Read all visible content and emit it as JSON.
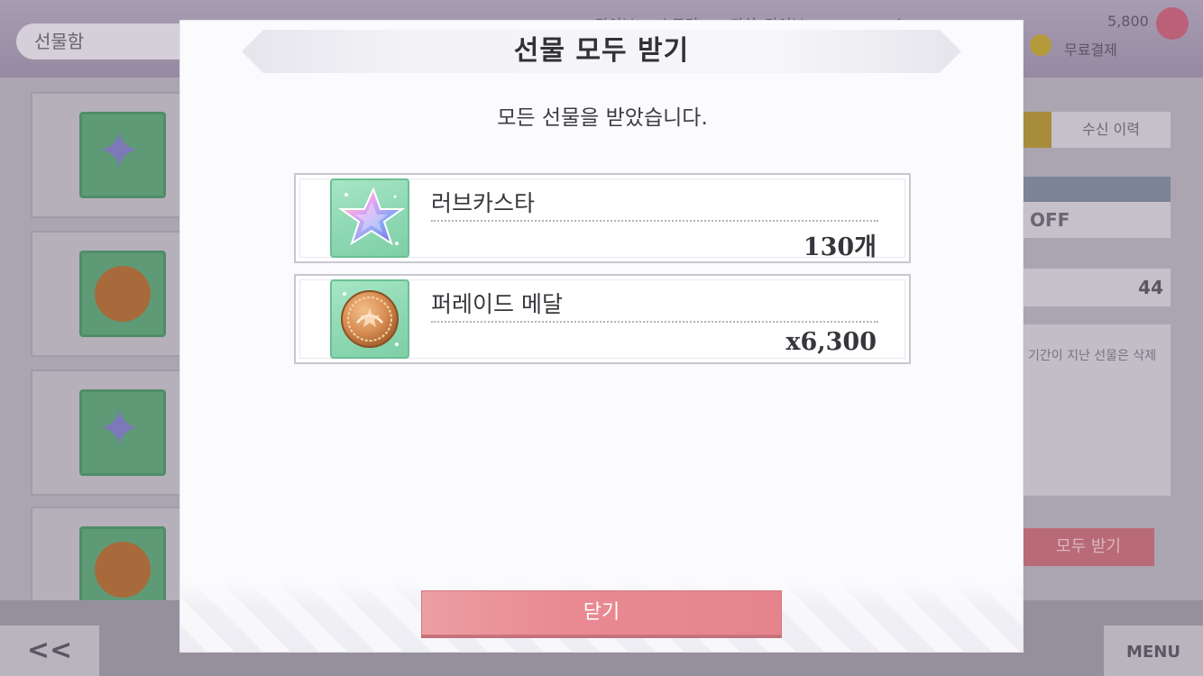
{
  "background": {
    "title": "선물함",
    "top_texts": [
      "라이브",
      "스토리",
      "가챠",
      "라이브",
      "쇼",
      "5,800",
      "무료결제"
    ],
    "history_button": "수신 이력",
    "toggle_value": "OFF",
    "count_value": "44",
    "note": "기간이 지난 선물은 삭제",
    "receive_all_button": "모두 받기",
    "back_label": "<<",
    "menu_label": "MENU"
  },
  "modal": {
    "title": "선물 모두 받기",
    "message": "모든 선물을 받았습니다.",
    "rewards": [
      {
        "name": "러브카스타",
        "quantity": "130개",
        "icon": "love-casta-star-icon"
      },
      {
        "name": "퍼레이드 메달",
        "quantity": "x6,300",
        "icon": "parade-medal-icon"
      }
    ],
    "close_label": "닫기"
  },
  "colors": {
    "close_button": "#e98a92",
    "icon_bg": "#8fd9b4",
    "modal_bg": "#fbfbfe"
  }
}
